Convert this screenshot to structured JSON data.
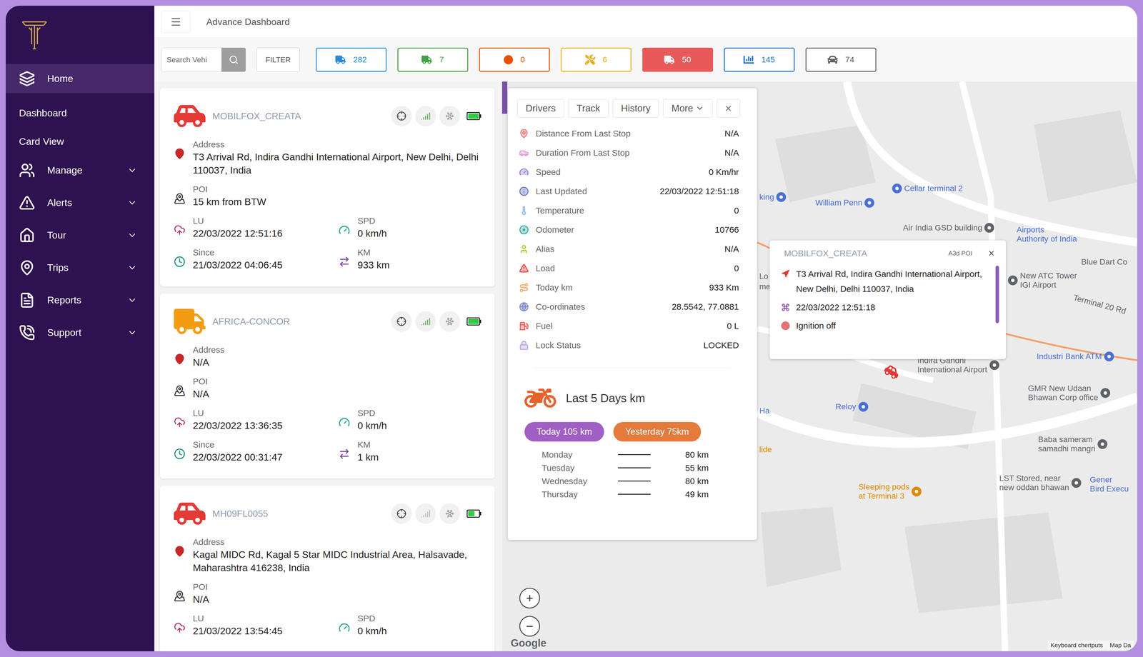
{
  "header": {
    "title": "Advance Dashboard"
  },
  "sidebar": {
    "items": [
      {
        "label": "Home",
        "kind": "main",
        "selected": true,
        "expandable": false,
        "expanded": false
      },
      {
        "label": "Dashboard",
        "kind": "sub",
        "selected": false,
        "expandable": false,
        "expanded": false
      },
      {
        "label": "Card View",
        "kind": "sub",
        "selected": false,
        "expandable": false,
        "expanded": false
      },
      {
        "label": "Manage",
        "kind": "main",
        "selected": false,
        "expandable": true,
        "expanded": false
      },
      {
        "label": "Alerts",
        "kind": "main",
        "selected": false,
        "expandable": true,
        "expanded": false
      },
      {
        "label": "Tour",
        "kind": "main",
        "selected": false,
        "expandable": true,
        "expanded": false
      },
      {
        "label": "Trips",
        "kind": "main",
        "selected": false,
        "expandable": true,
        "expanded": false
      },
      {
        "label": "Reports",
        "kind": "main",
        "selected": false,
        "expandable": true,
        "expanded": false
      },
      {
        "label": "Support",
        "kind": "main",
        "selected": false,
        "expandable": true,
        "expanded": false
      }
    ]
  },
  "toolbar": {
    "search_placeholder": "Search Vehi",
    "filter": "FILTER",
    "counters": [
      {
        "count": "282",
        "color": "#2a8bd6",
        "filled": false
      },
      {
        "count": "7",
        "color": "#43a047",
        "filled": false
      },
      {
        "count": "0",
        "color": "#e65100",
        "filled": false
      },
      {
        "count": "6",
        "color": "#e8b020",
        "filled": false
      },
      {
        "count": "50",
        "color": "#e85a5a",
        "filled": true
      },
      {
        "count": "145",
        "color": "#1e6fd9",
        "filled": false
      },
      {
        "count": "74",
        "color": "#616161",
        "filled": false
      }
    ]
  },
  "vehicles": [
    {
      "name": "MOBILFOX_CREATA",
      "type": "car",
      "color": "#e53935",
      "signal": true,
      "battery": 1,
      "address": {
        "label": "Address",
        "value": "T3 Arrival Rd, Indira Gandhi International Airport, New Delhi, Delhi 110037, India"
      },
      "poi": {
        "label": "POI",
        "value": "15 km from BTW"
      },
      "pairs": [
        [
          {
            "label": "LU",
            "value": "22/03/2022 12:51:16"
          },
          {
            "label": "SPD",
            "value": "0 km/h"
          }
        ],
        [
          {
            "label": "Since",
            "value": "21/03/2022 04:06:45"
          },
          {
            "label": "KM",
            "value": "933 km"
          }
        ]
      ]
    },
    {
      "name": "AFRICA-CONCOR",
      "type": "truck",
      "color": "#f39c12",
      "signal": true,
      "battery": 1,
      "address": {
        "label": "Address",
        "value": "N/A"
      },
      "poi": {
        "label": "POI",
        "value": "N/A"
      },
      "pairs": [
        [
          {
            "label": "LU",
            "value": "22/03/2022 13:36:35"
          },
          {
            "label": "SPD",
            "value": "0 km/h"
          }
        ],
        [
          {
            "label": "Since",
            "value": "22/03/2022 00:31:47"
          },
          {
            "label": "KM",
            "value": "1 km"
          }
        ]
      ]
    },
    {
      "name": "MH09FL0055",
      "type": "car",
      "color": "#e53935",
      "signal": false,
      "battery": 0.6,
      "address": {
        "label": "Address",
        "value": "Kagal MIDC Rd, Kagal 5 Star MIDC Industrial Area, Halsavade, Maharashtra 416238, India"
      },
      "poi": {
        "label": "POI",
        "value": "N/A"
      },
      "pairs": [
        [
          {
            "label": "LU",
            "value": "21/03/2022 13:54:45"
          },
          {
            "label": "SPD",
            "value": "0 km/h"
          }
        ]
      ]
    }
  ],
  "detail": {
    "tabs": [
      {
        "label": "Drivers",
        "selected": false,
        "kind": "tab"
      },
      {
        "label": "Track",
        "selected": false,
        "kind": "tab"
      },
      {
        "label": "History",
        "selected": false,
        "kind": "tab"
      },
      {
        "label": "More",
        "selected": false,
        "kind": "dropdown"
      }
    ],
    "close": "×",
    "rows": [
      {
        "label": "Distance From Last Stop",
        "value": "N/A",
        "color": "#e57373"
      },
      {
        "label": "Duration From Last Stop",
        "value": "N/A",
        "color": "#e58fd0"
      },
      {
        "label": "Speed",
        "value": "0 Km/hr",
        "color": "#9575cd"
      },
      {
        "label": "Last Updated",
        "value": "22/03/2022 12:51:18",
        "color": "#5c6bc0"
      },
      {
        "label": "Temperature",
        "value": "0",
        "color": "#90b4e8"
      },
      {
        "label": "Odometer",
        "value": "10766",
        "color": "#26a69a"
      },
      {
        "label": "Alias",
        "value": "N/A",
        "color": "#b5c234"
      },
      {
        "label": "Load",
        "value": "0",
        "color": "#e53935"
      },
      {
        "label": "Today km",
        "value": "933 Km",
        "color": "#f0a860"
      },
      {
        "label": "Co-ordinates",
        "value": "28.5542, 77.0881",
        "color": "#7986cb"
      },
      {
        "label": "Fuel",
        "value": "0 L",
        "color": "#ef5350"
      },
      {
        "label": "Lock Status",
        "value": "LOCKED",
        "color": "#b39ddb"
      }
    ],
    "summary": {
      "title": "Last 5 Days km",
      "today": {
        "label": "Today 105 km",
        "color": "#a05fc4"
      },
      "yesterday": {
        "label": "Yesterday 75km",
        "color": "#e47a3c"
      },
      "days": [
        {
          "day": "Monday",
          "km": "80 km"
        },
        {
          "day": "Tuesday",
          "km": "55 km"
        },
        {
          "day": "Wednesday",
          "km": "80 km"
        },
        {
          "day": "Thursday",
          "km": "49 km"
        }
      ]
    }
  },
  "map": {
    "labels": [
      {
        "lines": [
          "Cellar terminal 2"
        ],
        "color": "#4a6fd6",
        "pin": true
      },
      {
        "lines": [
          "William Penn"
        ],
        "color": "#4a6fd6",
        "pin": true
      },
      {
        "lines": [
          "king"
        ],
        "color": "#4a6fd6",
        "pin": true
      },
      {
        "lines": [
          "Air India GSD building"
        ],
        "color": "#5f6368",
        "pin": true
      },
      {
        "lines": [
          "Airports",
          "Authority of India"
        ],
        "color": "#4a6fd6",
        "pin": false
      },
      {
        "lines": [
          "New ATC Tower",
          "IGI Airport"
        ],
        "color": "#5f6368",
        "pin": true
      },
      {
        "lines": [
          "Blue Dart Co"
        ],
        "color": "#5f6368",
        "pin": false
      },
      {
        "lines": [
          "Terminal 20 Rd"
        ],
        "color": "#5f6368",
        "pin": false
      },
      {
        "lines": [
          "Industri Bank ATM"
        ],
        "color": "#4a6fd6",
        "pin": true
      },
      {
        "lines": [
          "Indira Gandhi",
          "International Airport"
        ],
        "color": "#5f6368",
        "pin": true
      },
      {
        "lines": [
          "GMR New Udaan",
          "Bhawan Corp office"
        ],
        "color": "#5f6368",
        "pin": true
      },
      {
        "lines": [
          "Reloy"
        ],
        "color": "#4a6fd6",
        "pin": true
      },
      {
        "lines": [
          "Baba sameram",
          "samadhi mangri"
        ],
        "color": "#5f6368",
        "pin": true
      },
      {
        "lines": [
          "LST Stored, near",
          "new oddan bhawan"
        ],
        "color": "#5f6368",
        "pin": true
      },
      {
        "lines": [
          "Sleeping pods",
          "at Terminal 3"
        ],
        "color": "#e08a00",
        "pin": true
      },
      {
        "lines": [
          "Gener",
          "Bird Execu"
        ],
        "color": "#4a6fd6",
        "pin": false
      },
      {
        "lines": [
          "Lo"
        ],
        "color": "#5f6368",
        "pin": false
      },
      {
        "lines": [
          "me"
        ],
        "color": "#5f6368",
        "pin": false
      },
      {
        "lines": [
          "Ha"
        ],
        "color": "#4a6fd6",
        "pin": false
      },
      {
        "lines": [
          "lide"
        ],
        "color": "#e08a00",
        "pin": false
      }
    ],
    "vehicle_marker": {
      "color": "#e53935"
    },
    "popup": {
      "title": "MOBILFOX_CREATA",
      "tag": "A3d POI",
      "close": "×",
      "address": "T3 Arrival Rd, Indira Gandhi International Airport, New Delhi, Delhi 110037, India",
      "time": "22/03/2022 12:51:18",
      "status": {
        "label": "Ignition off",
        "color": "#e57373"
      }
    },
    "zoom": [
      "+",
      "−"
    ],
    "logo": "Google",
    "footer": [
      "Keyboard chertputs",
      "Map Da"
    ]
  }
}
